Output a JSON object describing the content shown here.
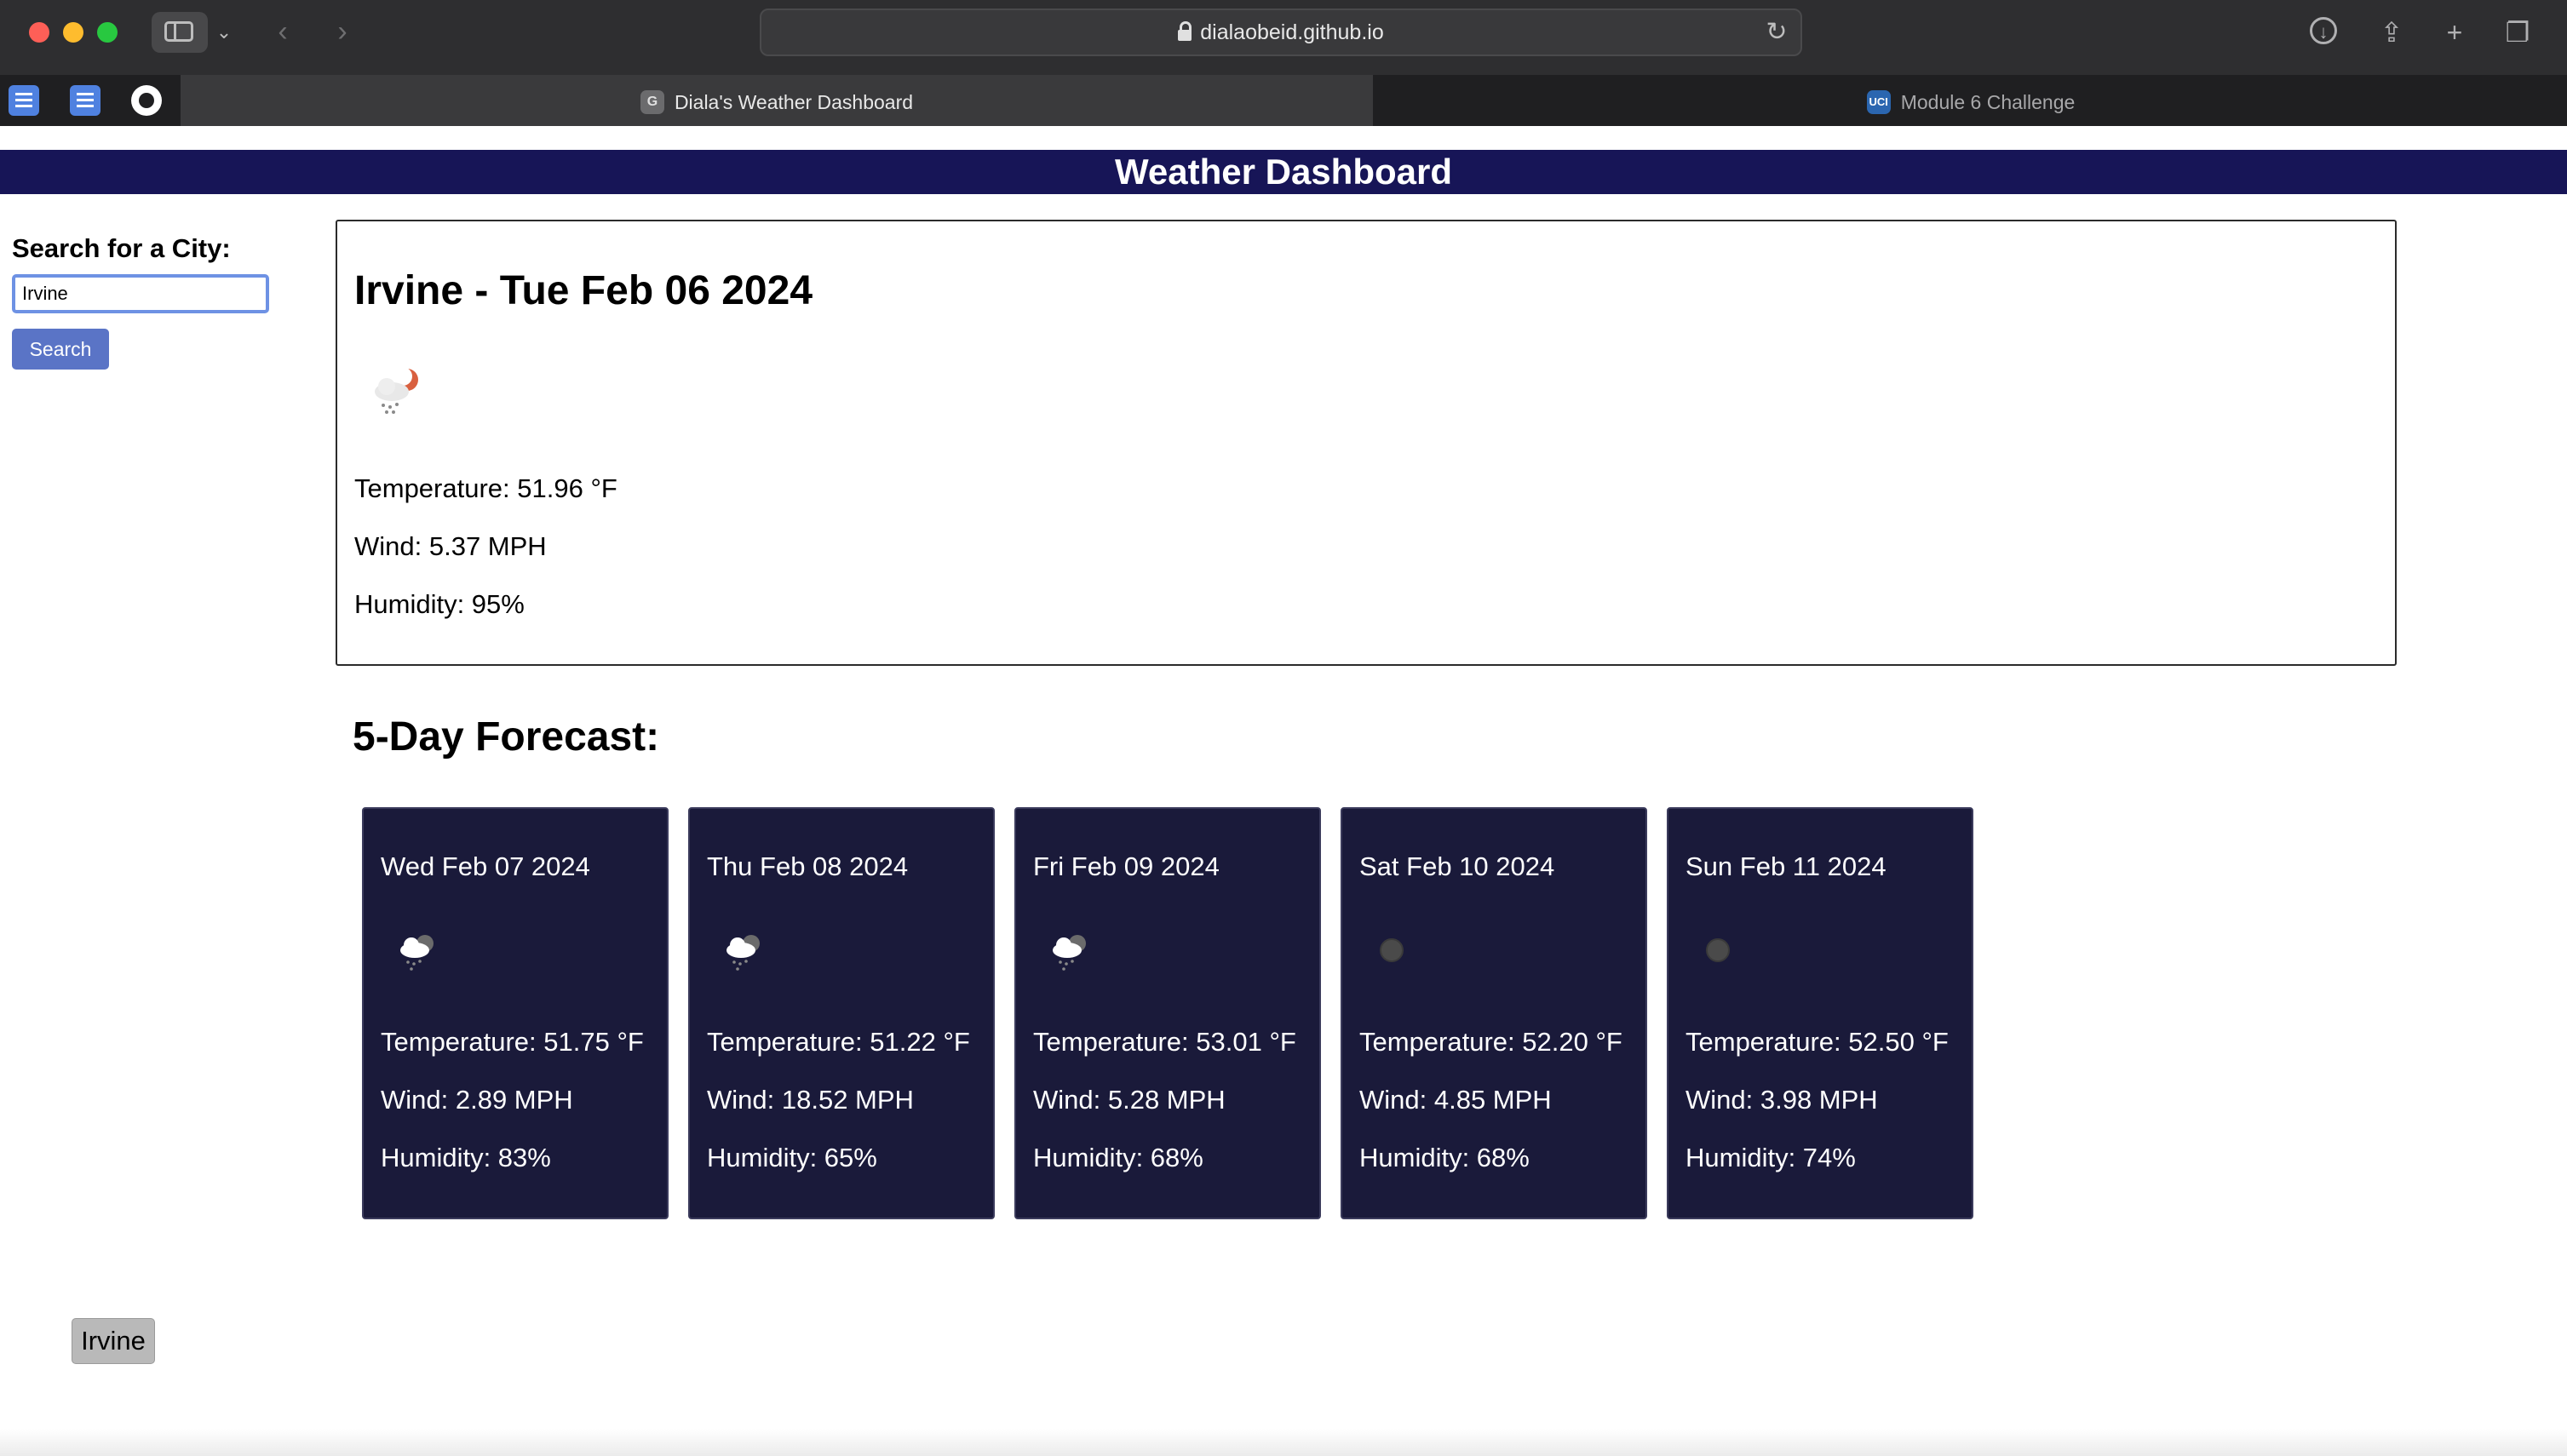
{
  "browser": {
    "url": "dialaobeid.github.io",
    "tabs": [
      {
        "title": "Diala's Weather Dashboard",
        "favicon": "G",
        "active": true
      },
      {
        "title": "Module 6 Challenge",
        "favicon": "UCI",
        "active": false
      }
    ],
    "bookmark_icons": [
      "docs-icon",
      "docs-icon",
      "github-icon"
    ],
    "toolbar_icons": [
      "sidebar-icon",
      "chevron-down-icon",
      "back-arrow-icon",
      "forward-arrow-icon",
      "reload-icon",
      "downloads-icon",
      "share-icon",
      "new-tab-icon",
      "tab-overview-icon"
    ]
  },
  "header": {
    "title": "Weather Dashboard",
    "background": "#171557"
  },
  "search": {
    "label": "Search for a City:",
    "value": "Irvine",
    "button_label": "Search",
    "button_color": "#5a74c6"
  },
  "current": {
    "title": "Irvine - Tue Feb 06 2024",
    "icon": "rain-night-icon",
    "temperature": "Temperature: 51.96 °F",
    "wind": "Wind: 5.37 MPH",
    "humidity": "Humidity: 95%"
  },
  "forecast": {
    "title": "5-Day Forecast:",
    "card_color": "#1a1a3a",
    "days": [
      {
        "date": "Wed Feb 07 2024",
        "icon": "rain-cloud-icon",
        "temperature": "Temperature: 51.75 °F",
        "wind": "Wind: 2.89 MPH",
        "humidity": "Humidity: 83%"
      },
      {
        "date": "Thu Feb 08 2024",
        "icon": "rain-cloud-icon",
        "temperature": "Temperature: 51.22 °F",
        "wind": "Wind: 18.52 MPH",
        "humidity": "Humidity: 65%"
      },
      {
        "date": "Fri Feb 09 2024",
        "icon": "rain-cloud-icon",
        "temperature": "Temperature: 53.01 °F",
        "wind": "Wind: 5.28 MPH",
        "humidity": "Humidity: 68%"
      },
      {
        "date": "Sat Feb 10 2024",
        "icon": "clear-night-icon",
        "temperature": "Temperature: 52.20 °F",
        "wind": "Wind: 4.85 MPH",
        "humidity": "Humidity: 68%"
      },
      {
        "date": "Sun Feb 11 2024",
        "icon": "clear-night-icon",
        "temperature": "Temperature: 52.50 °F",
        "wind": "Wind: 3.98 MPH",
        "humidity": "Humidity: 74%"
      }
    ]
  },
  "history": [
    "Irvine"
  ]
}
